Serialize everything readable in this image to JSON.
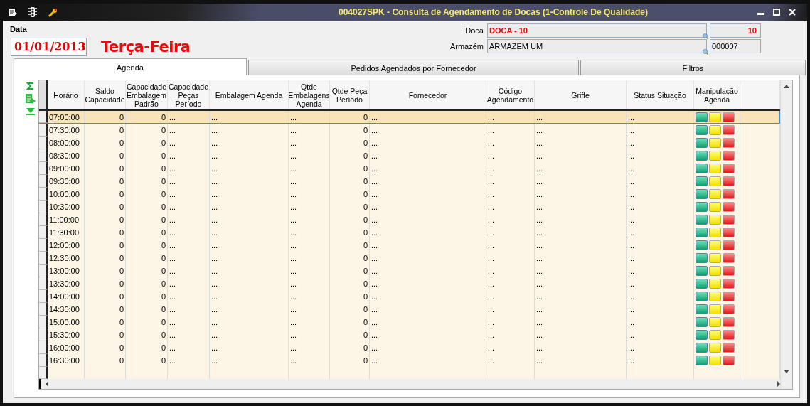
{
  "window": {
    "title": "004027SPK - Consulta de Agendamento de Docas (1-Controle De Qualidade)"
  },
  "data_label": "Data",
  "date": "01/01/2013",
  "weekday": "Terça-Feira",
  "doca": {
    "label": "Doca",
    "name": "DOCA - 10",
    "code": "10"
  },
  "armazem": {
    "label": "Armazém",
    "name": "ARMAZEM UM",
    "code": "000007"
  },
  "tabs": [
    {
      "label": "Agenda",
      "selected": true
    },
    {
      "label": "Pedidos Agendados por Fornecedor",
      "selected": false
    },
    {
      "label": "Filtros",
      "selected": false
    }
  ],
  "table": {
    "columns": [
      {
        "label": "Horário",
        "kind": "time"
      },
      {
        "label": "Saldo Capacidade",
        "kind": "number"
      },
      {
        "label": "Capacidade Embalagem Padrão",
        "kind": "number"
      },
      {
        "label": "Capacidade Peças Período",
        "kind": "text"
      },
      {
        "label": "Embalagem Agenda",
        "kind": "text"
      },
      {
        "label": "Qtde Embalagens Agenda",
        "kind": "text"
      },
      {
        "label": "Qtde Peça Período",
        "kind": "number"
      },
      {
        "label": "Fornecedor",
        "kind": "text"
      },
      {
        "label": "Código Agendamento",
        "kind": "text"
      },
      {
        "label": "Griffe",
        "kind": "text"
      },
      {
        "label": "Status Situação",
        "kind": "text"
      },
      {
        "label": "Manipulação Agenda",
        "kind": "actions"
      }
    ],
    "rows": [
      {
        "selected": true,
        "cells": [
          "07:00:00",
          "0",
          "0",
          "...",
          "...",
          "...",
          "0",
          "...",
          "...",
          "...",
          "..."
        ]
      },
      {
        "selected": false,
        "cells": [
          "07:30:00",
          "0",
          "0",
          "...",
          "...",
          "...",
          "0",
          "...",
          "...",
          "...",
          "..."
        ]
      },
      {
        "selected": false,
        "cells": [
          "08:00:00",
          "0",
          "0",
          "...",
          "...",
          "...",
          "0",
          "...",
          "...",
          "...",
          "..."
        ]
      },
      {
        "selected": false,
        "cells": [
          "08:30:00",
          "0",
          "0",
          "...",
          "...",
          "...",
          "0",
          "...",
          "...",
          "...",
          "..."
        ]
      },
      {
        "selected": false,
        "cells": [
          "09:00:00",
          "0",
          "0",
          "...",
          "...",
          "...",
          "0",
          "...",
          "...",
          "...",
          "..."
        ]
      },
      {
        "selected": false,
        "cells": [
          "09:30:00",
          "0",
          "0",
          "...",
          "...",
          "...",
          "0",
          "...",
          "...",
          "...",
          "..."
        ]
      },
      {
        "selected": false,
        "cells": [
          "10:00:00",
          "0",
          "0",
          "...",
          "...",
          "...",
          "0",
          "...",
          "...",
          "...",
          "..."
        ]
      },
      {
        "selected": false,
        "cells": [
          "10:30:00",
          "0",
          "0",
          "...",
          "...",
          "...",
          "0",
          "...",
          "...",
          "...",
          "..."
        ]
      },
      {
        "selected": false,
        "cells": [
          "11:00:00",
          "0",
          "0",
          "...",
          "...",
          "...",
          "0",
          "...",
          "...",
          "...",
          "..."
        ]
      },
      {
        "selected": false,
        "cells": [
          "11:30:00",
          "0",
          "0",
          "...",
          "...",
          "...",
          "0",
          "...",
          "...",
          "...",
          "..."
        ]
      },
      {
        "selected": false,
        "cells": [
          "12:00:00",
          "0",
          "0",
          "...",
          "...",
          "...",
          "0",
          "...",
          "...",
          "...",
          "..."
        ]
      },
      {
        "selected": false,
        "cells": [
          "12:30:00",
          "0",
          "0",
          "...",
          "...",
          "...",
          "0",
          "...",
          "...",
          "...",
          "..."
        ]
      },
      {
        "selected": false,
        "cells": [
          "13:00:00",
          "0",
          "0",
          "...",
          "...",
          "...",
          "0",
          "...",
          "...",
          "...",
          "..."
        ]
      },
      {
        "selected": false,
        "cells": [
          "13:30:00",
          "0",
          "0",
          "...",
          "...",
          "...",
          "0",
          "...",
          "...",
          "...",
          "..."
        ]
      },
      {
        "selected": false,
        "cells": [
          "14:00:00",
          "0",
          "0",
          "...",
          "...",
          "...",
          "0",
          "...",
          "...",
          "...",
          "..."
        ]
      },
      {
        "selected": false,
        "cells": [
          "14:30:00",
          "0",
          "0",
          "...",
          "...",
          "...",
          "0",
          "...",
          "...",
          "...",
          "..."
        ]
      },
      {
        "selected": false,
        "cells": [
          "15:00:00",
          "0",
          "0",
          "...",
          "...",
          "...",
          "0",
          "...",
          "...",
          "...",
          "..."
        ]
      },
      {
        "selected": false,
        "cells": [
          "15:30:00",
          "0",
          "0",
          "...",
          "...",
          "...",
          "0",
          "...",
          "...",
          "...",
          "..."
        ]
      },
      {
        "selected": false,
        "cells": [
          "16:00:00",
          "0",
          "0",
          "...",
          "...",
          "...",
          "0",
          "...",
          "...",
          "...",
          "..."
        ]
      },
      {
        "selected": false,
        "cells": [
          "16:30:00",
          "0",
          "0",
          "...",
          "...",
          "...",
          "0",
          "...",
          "...",
          "...",
          "..."
        ]
      }
    ]
  }
}
